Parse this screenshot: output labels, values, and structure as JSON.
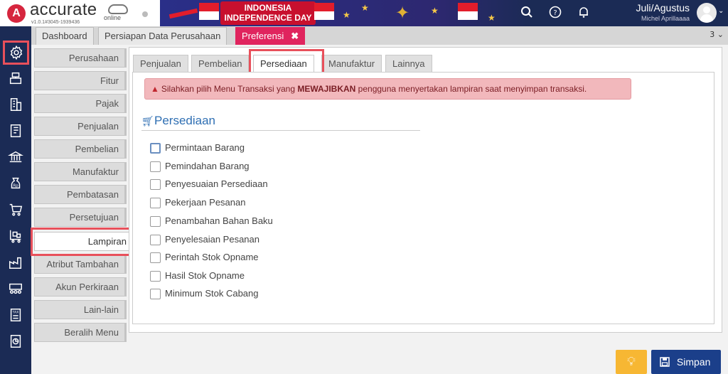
{
  "app": {
    "brand": "accurate",
    "brand_sub": "online",
    "version": "v1.0.1#3045-1939436"
  },
  "banner": {
    "line1": "INDONESIA",
    "line2": "INDEPENDENCE DAY"
  },
  "user": {
    "period": "Juli/Agustus",
    "name": "Michel Aprillaaaa"
  },
  "page_tabs": [
    {
      "label": "Dashboard"
    },
    {
      "label": "Persiapan Data Perusahaan"
    },
    {
      "label": "Preferensi",
      "close": "✖"
    }
  ],
  "tab_counter": "3 ⌄",
  "left_menu": [
    {
      "label": "Perusahaan"
    },
    {
      "label": "Fitur"
    },
    {
      "label": "Pajak"
    },
    {
      "label": "Penjualan"
    },
    {
      "label": "Pembelian"
    },
    {
      "label": "Manufaktur"
    },
    {
      "label": "Pembatasan"
    },
    {
      "label": "Persetujuan"
    },
    {
      "label": "Lampiran"
    },
    {
      "label": "Atribut Tambahan"
    },
    {
      "label": "Akun Perkiraan"
    },
    {
      "label": "Lain-lain"
    },
    {
      "label": "Beralih Menu"
    }
  ],
  "sub_tabs": [
    {
      "label": "Penjualan"
    },
    {
      "label": "Pembelian"
    },
    {
      "label": "Persediaan"
    },
    {
      "label": "Manufaktur"
    },
    {
      "label": "Lainnya"
    }
  ],
  "alert": {
    "icon": "warning-icon",
    "text_before": "Silahkan pilih Menu Transaksi yang ",
    "text_bold": "MEWAJIBKAN",
    "text_after": " pengguna menyertakan lampiran saat menyimpan transaksi.",
    "color": "#f2b8bc"
  },
  "section": {
    "title": "Persediaan"
  },
  "checkboxes": [
    {
      "label": "Permintaan Barang",
      "checked": false
    },
    {
      "label": "Pemindahan Barang",
      "checked": false
    },
    {
      "label": "Penyesuaian Persediaan",
      "checked": false
    },
    {
      "label": "Pekerjaan Pesanan",
      "checked": false
    },
    {
      "label": "Penambahan Bahan Baku",
      "checked": false
    },
    {
      "label": "Penyelesaian Pesanan",
      "checked": false
    },
    {
      "label": "Perintah Stok Opname",
      "checked": false
    },
    {
      "label": "Hasil Stok Opname",
      "checked": false
    },
    {
      "label": "Minimum Stok Cabang",
      "checked": false
    }
  ],
  "footer": {
    "hint_icon": "lightbulb-icon",
    "save_label": "Simpan",
    "save_icon": "floppy-icon"
  },
  "colors": {
    "accent": "#e0245e",
    "sidebar": "#1b2b55",
    "highlight": "#e8505b",
    "save_button": "#1b3f8a",
    "hint_button": "#f7b733"
  }
}
